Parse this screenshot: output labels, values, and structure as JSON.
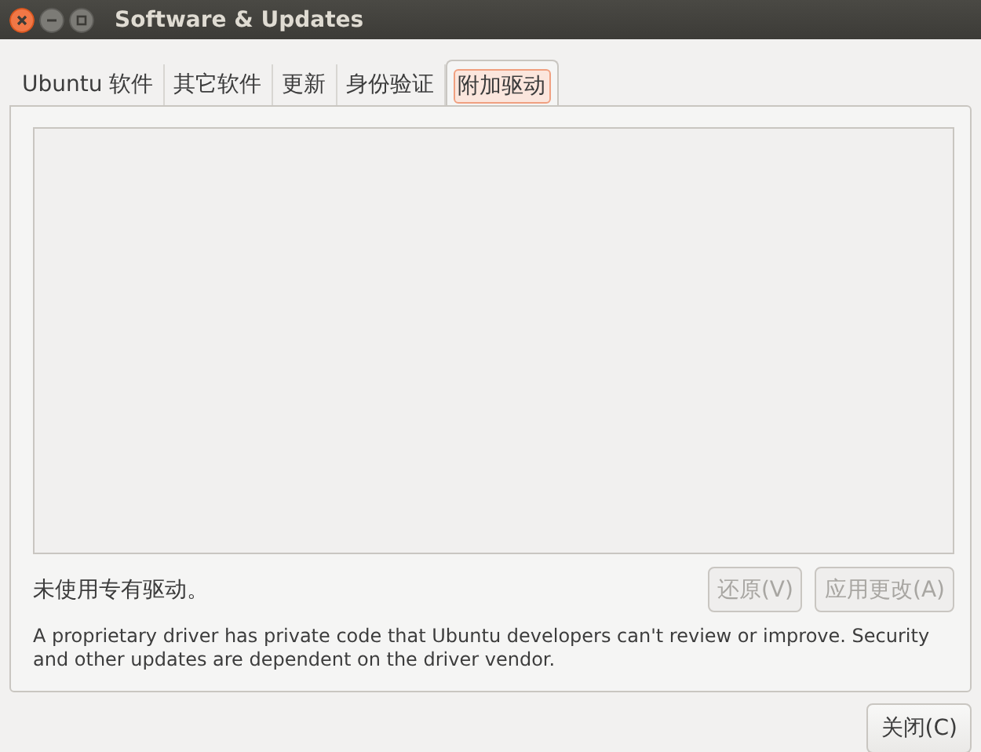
{
  "window": {
    "title": "Software & Updates",
    "controls": [
      {
        "kind": "close"
      },
      {
        "kind": "minimize"
      },
      {
        "kind": "maximize"
      }
    ]
  },
  "tabs": [
    {
      "label": "Ubuntu 软件",
      "selected": false
    },
    {
      "label": "其它软件",
      "selected": false
    },
    {
      "label": "更新",
      "selected": false
    },
    {
      "label": "身份验证",
      "selected": false
    },
    {
      "label": "附加驱动",
      "selected": true
    }
  ],
  "status": "未使用专有驱动。",
  "actions": [
    {
      "label": "还原(V)",
      "disabled": true
    },
    {
      "label": "应用更改(A)",
      "disabled": true
    }
  ],
  "description": "A proprietary driver has private code that Ubuntu developers can't review or improve. Security and other updates are dependent on the driver vendor.",
  "footer_buttons": [
    {
      "label": "关闭(C)",
      "disabled": false
    }
  ]
}
